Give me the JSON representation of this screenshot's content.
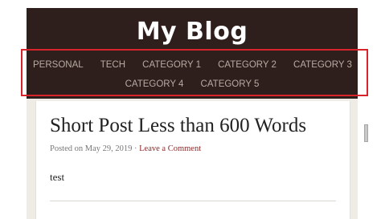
{
  "site": {
    "title": "My Blog"
  },
  "nav": {
    "row1": [
      "PERSONAL",
      "TECH",
      "CATEGORY 1",
      "CATEGORY 2",
      "CATEGORY 3"
    ],
    "row2": [
      "CATEGORY 4",
      "CATEGORY 5"
    ]
  },
  "post": {
    "title": "Short Post Less than 600 Words",
    "meta_prefix": "Posted on ",
    "date": "May 29, 2019",
    "separator": " · ",
    "comment_link": "Leave a Comment",
    "body": "test"
  },
  "colors": {
    "header_bg": "#2e1f1c",
    "nav_text": "#b7aaa3",
    "highlight": "#d8232a",
    "link": "#8b2a2a"
  }
}
